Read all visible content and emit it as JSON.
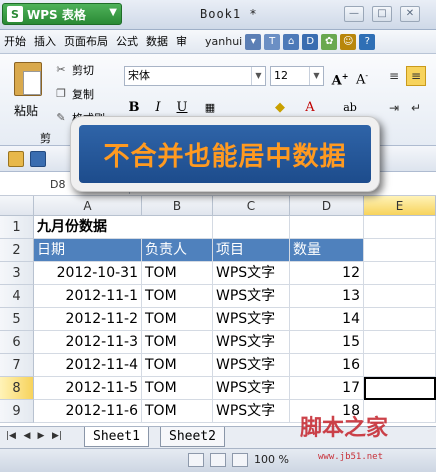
{
  "app": {
    "name": "WPS 表格",
    "logo": "S",
    "document_title": "Book1 *"
  },
  "menu": {
    "items": [
      "开始",
      "插入",
      "页面布局",
      "公式",
      "数据",
      "审"
    ],
    "user": "yanhui"
  },
  "ribbon": {
    "paste": "粘贴",
    "cut": "剪切",
    "copy": "复制",
    "format_painter": "格式刷",
    "font_name": "宋体",
    "font_size": "12",
    "bold": "B",
    "italic": "I",
    "underline": "U",
    "clip_group_partial": "剪"
  },
  "callout": {
    "text": "不合并也能居中数据"
  },
  "namebox": {
    "value": "D8"
  },
  "columns": [
    "A",
    "B",
    "C",
    "D",
    "E"
  ],
  "rows": [
    "1",
    "2",
    "3",
    "4",
    "5",
    "6",
    "7",
    "8",
    "9"
  ],
  "active_cell": {
    "column": "E",
    "row": "8"
  },
  "sheet": {
    "title_cell": "九月份数据",
    "headers": [
      "日期",
      "负责人",
      "项目",
      "数量"
    ],
    "data": [
      {
        "date": "2012-10-31",
        "owner": "TOM",
        "project": "WPS文字",
        "qty": "12"
      },
      {
        "date": "2012-11-1",
        "owner": "TOM",
        "project": "WPS文字",
        "qty": "13"
      },
      {
        "date": "2012-11-2",
        "owner": "TOM",
        "project": "WPS文字",
        "qty": "14"
      },
      {
        "date": "2012-11-3",
        "owner": "TOM",
        "project": "WPS文字",
        "qty": "15"
      },
      {
        "date": "2012-11-4",
        "owner": "TOM",
        "project": "WPS文字",
        "qty": "16"
      },
      {
        "date": "2012-11-5",
        "owner": "TOM",
        "project": "WPS文字",
        "qty": "17"
      },
      {
        "date": "2012-11-6",
        "owner": "TOM",
        "project": "WPS文字",
        "qty": "18"
      }
    ]
  },
  "tabs": [
    "Sheet1",
    "Sheet2"
  ],
  "status": {
    "zoom": "100 %"
  },
  "watermark": {
    "text": "脚本之家",
    "url": "www.jb51.net"
  },
  "colors": {
    "header_fill": "#4f81bd",
    "callout_bg": "#1d4c8c",
    "callout_text": "#ff9a20",
    "app_green": "#2a8a35"
  }
}
